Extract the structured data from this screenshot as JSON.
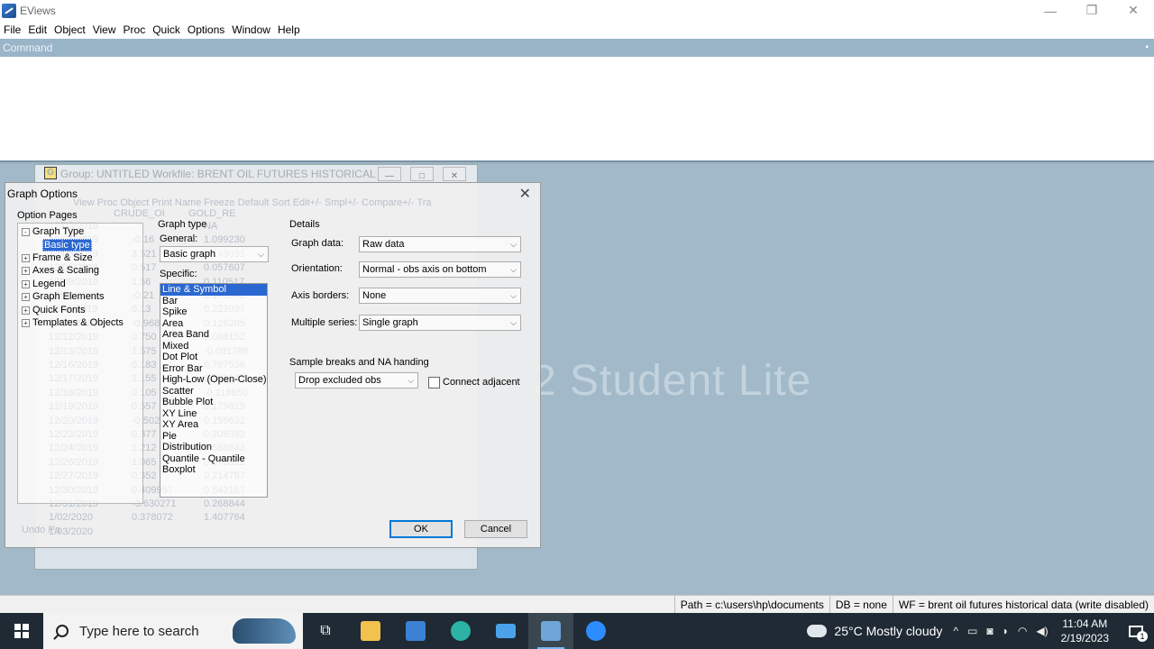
{
  "app": {
    "title": "EViews",
    "menu": [
      "File",
      "Edit",
      "Object",
      "View",
      "Proc",
      "Quick",
      "Options",
      "Window",
      "Help"
    ],
    "command_label": "Command",
    "watermark": "2 Student Lite"
  },
  "group_window": {
    "icon_letter": "G",
    "title": "Group: UNTITLED   Workfile: BRENT OIL FUTURES HISTORICAL D...",
    "toolbar": "View  Proc  Object   Print  Name  Freeze   Default       Sort  Edit+/-  Smpl+/-  Compare+/-  Tra",
    "col_headers": [
      "CRUDE_OI",
      "GOLD_RE"
    ],
    "rows": [
      {
        "date": "12/03/2019",
        "a": "",
        "b": "NA"
      },
      {
        "date": "12/04/2019",
        "a": "-0.16",
        "b": "1.099230"
      },
      {
        "date": "12/05/2019",
        "a": "3.521",
        "b": "0.149031"
      },
      {
        "date": "12/06/2019",
        "a": "0.517",
        "b": "0.057607"
      },
      {
        "date": "12/09/2019",
        "a": "1.56",
        "b": "0.110517"
      },
      {
        "date": "12/10/2019",
        "a": "-0.21",
        "b": "0.140346"
      },
      {
        "date": "12/11/2019",
        "a": "0.13",
        "b": "0.222097"
      },
      {
        "date": "12/11/2019",
        "a": "-0.968",
        "b": "0.126205"
      },
      {
        "date": "12/12/2019",
        "a": "0.750",
        "b": "0.068152"
      },
      {
        "date": "12/13/2019",
        "a": "1.575",
        "b": "-0.081788"
      },
      {
        "date": "12/16/2019",
        "a": "0.183",
        "b": "0.767536"
      },
      {
        "date": "12/17/2019",
        "a": "1.155",
        "b": "0.102143"
      },
      {
        "date": "12/18/2019",
        "a": "0.105",
        "b": "-0.118650"
      },
      {
        "date": "12/19/2019",
        "a": "0.557",
        "b": "0.179615"
      },
      {
        "date": "12/20/2019",
        "a": "-0.502",
        "b": "0.155632"
      },
      {
        "date": "12/23/2019",
        "a": "0.377",
        "b": "0.209382"
      },
      {
        "date": "12/24/2019",
        "a": "1.212",
        "b": "0.588643"
      },
      {
        "date": "12/26/2019",
        "a": "1.065",
        "b": "0.078511"
      },
      {
        "date": "12/27/2019",
        "a": "0.352",
        "b": "0.214787"
      },
      {
        "date": "12/30/2019",
        "a": "0.409957",
        "b": "0.543167"
      },
      {
        "date": "12/31/2019",
        "a": "-3.630271",
        "b": "0.268844"
      },
      {
        "date": "1/02/2020",
        "a": "0.378072",
        "b": "1.407764"
      },
      {
        "date": "1/03/2020",
        "a": "",
        "b": ""
      }
    ],
    "undo_label": "Undo Pa"
  },
  "dialog": {
    "title": "Graph Options",
    "option_pages_label": "Option Pages",
    "tree": [
      {
        "label": "Graph Type",
        "expander": "-"
      },
      {
        "label": "Basic type",
        "expander": "",
        "selected": true
      },
      {
        "label": "Frame & Size",
        "expander": "+"
      },
      {
        "label": "Axes & Scaling",
        "expander": "+"
      },
      {
        "label": "Legend",
        "expander": "+"
      },
      {
        "label": "Graph Elements",
        "expander": "+"
      },
      {
        "label": "Quick Fonts",
        "expander": "+"
      },
      {
        "label": "Templates & Objects",
        "expander": "+"
      }
    ],
    "graph_type_label": "Graph type",
    "general_label": "General:",
    "general_value": "Basic graph",
    "specific_label": "Specific:",
    "specific_items": [
      "Line & Symbol",
      "Bar",
      "Spike",
      "Area",
      "Area Band",
      "Mixed",
      "Dot Plot",
      "Error Bar",
      "High-Low (Open-Close)",
      "Scatter",
      "Bubble Plot",
      "XY Line",
      "XY Area",
      "Pie",
      "Distribution",
      "Quantile - Quantile",
      "Boxplot"
    ],
    "specific_selected": "Line & Symbol",
    "details_label": "Details",
    "details": [
      {
        "label": "Graph data:",
        "value": "Raw data"
      },
      {
        "label": "Orientation:",
        "value": "Normal - obs axis on bottom"
      },
      {
        "label": "Axis borders:",
        "value": "None"
      },
      {
        "label": "Multiple series:",
        "value": "Single graph"
      }
    ],
    "sample_breaks_label": "Sample breaks and NA handing",
    "sample_breaks_value": "Drop excluded obs",
    "connect_adjacent_label": "Connect adjacent",
    "connect_adjacent_checked": false,
    "ok_label": "OK",
    "cancel_label": "Cancel"
  },
  "status": {
    "path": "Path = c:\\users\\hp\\documents",
    "db": "DB = none",
    "wf": "WF = brent oil futures historical data (write disabled)"
  },
  "taskbar": {
    "search_placeholder": "Type here to search",
    "weather": "25°C  Mostly cloudy",
    "time": "11:04 AM",
    "date": "2/19/2023",
    "notification_count": "1"
  }
}
